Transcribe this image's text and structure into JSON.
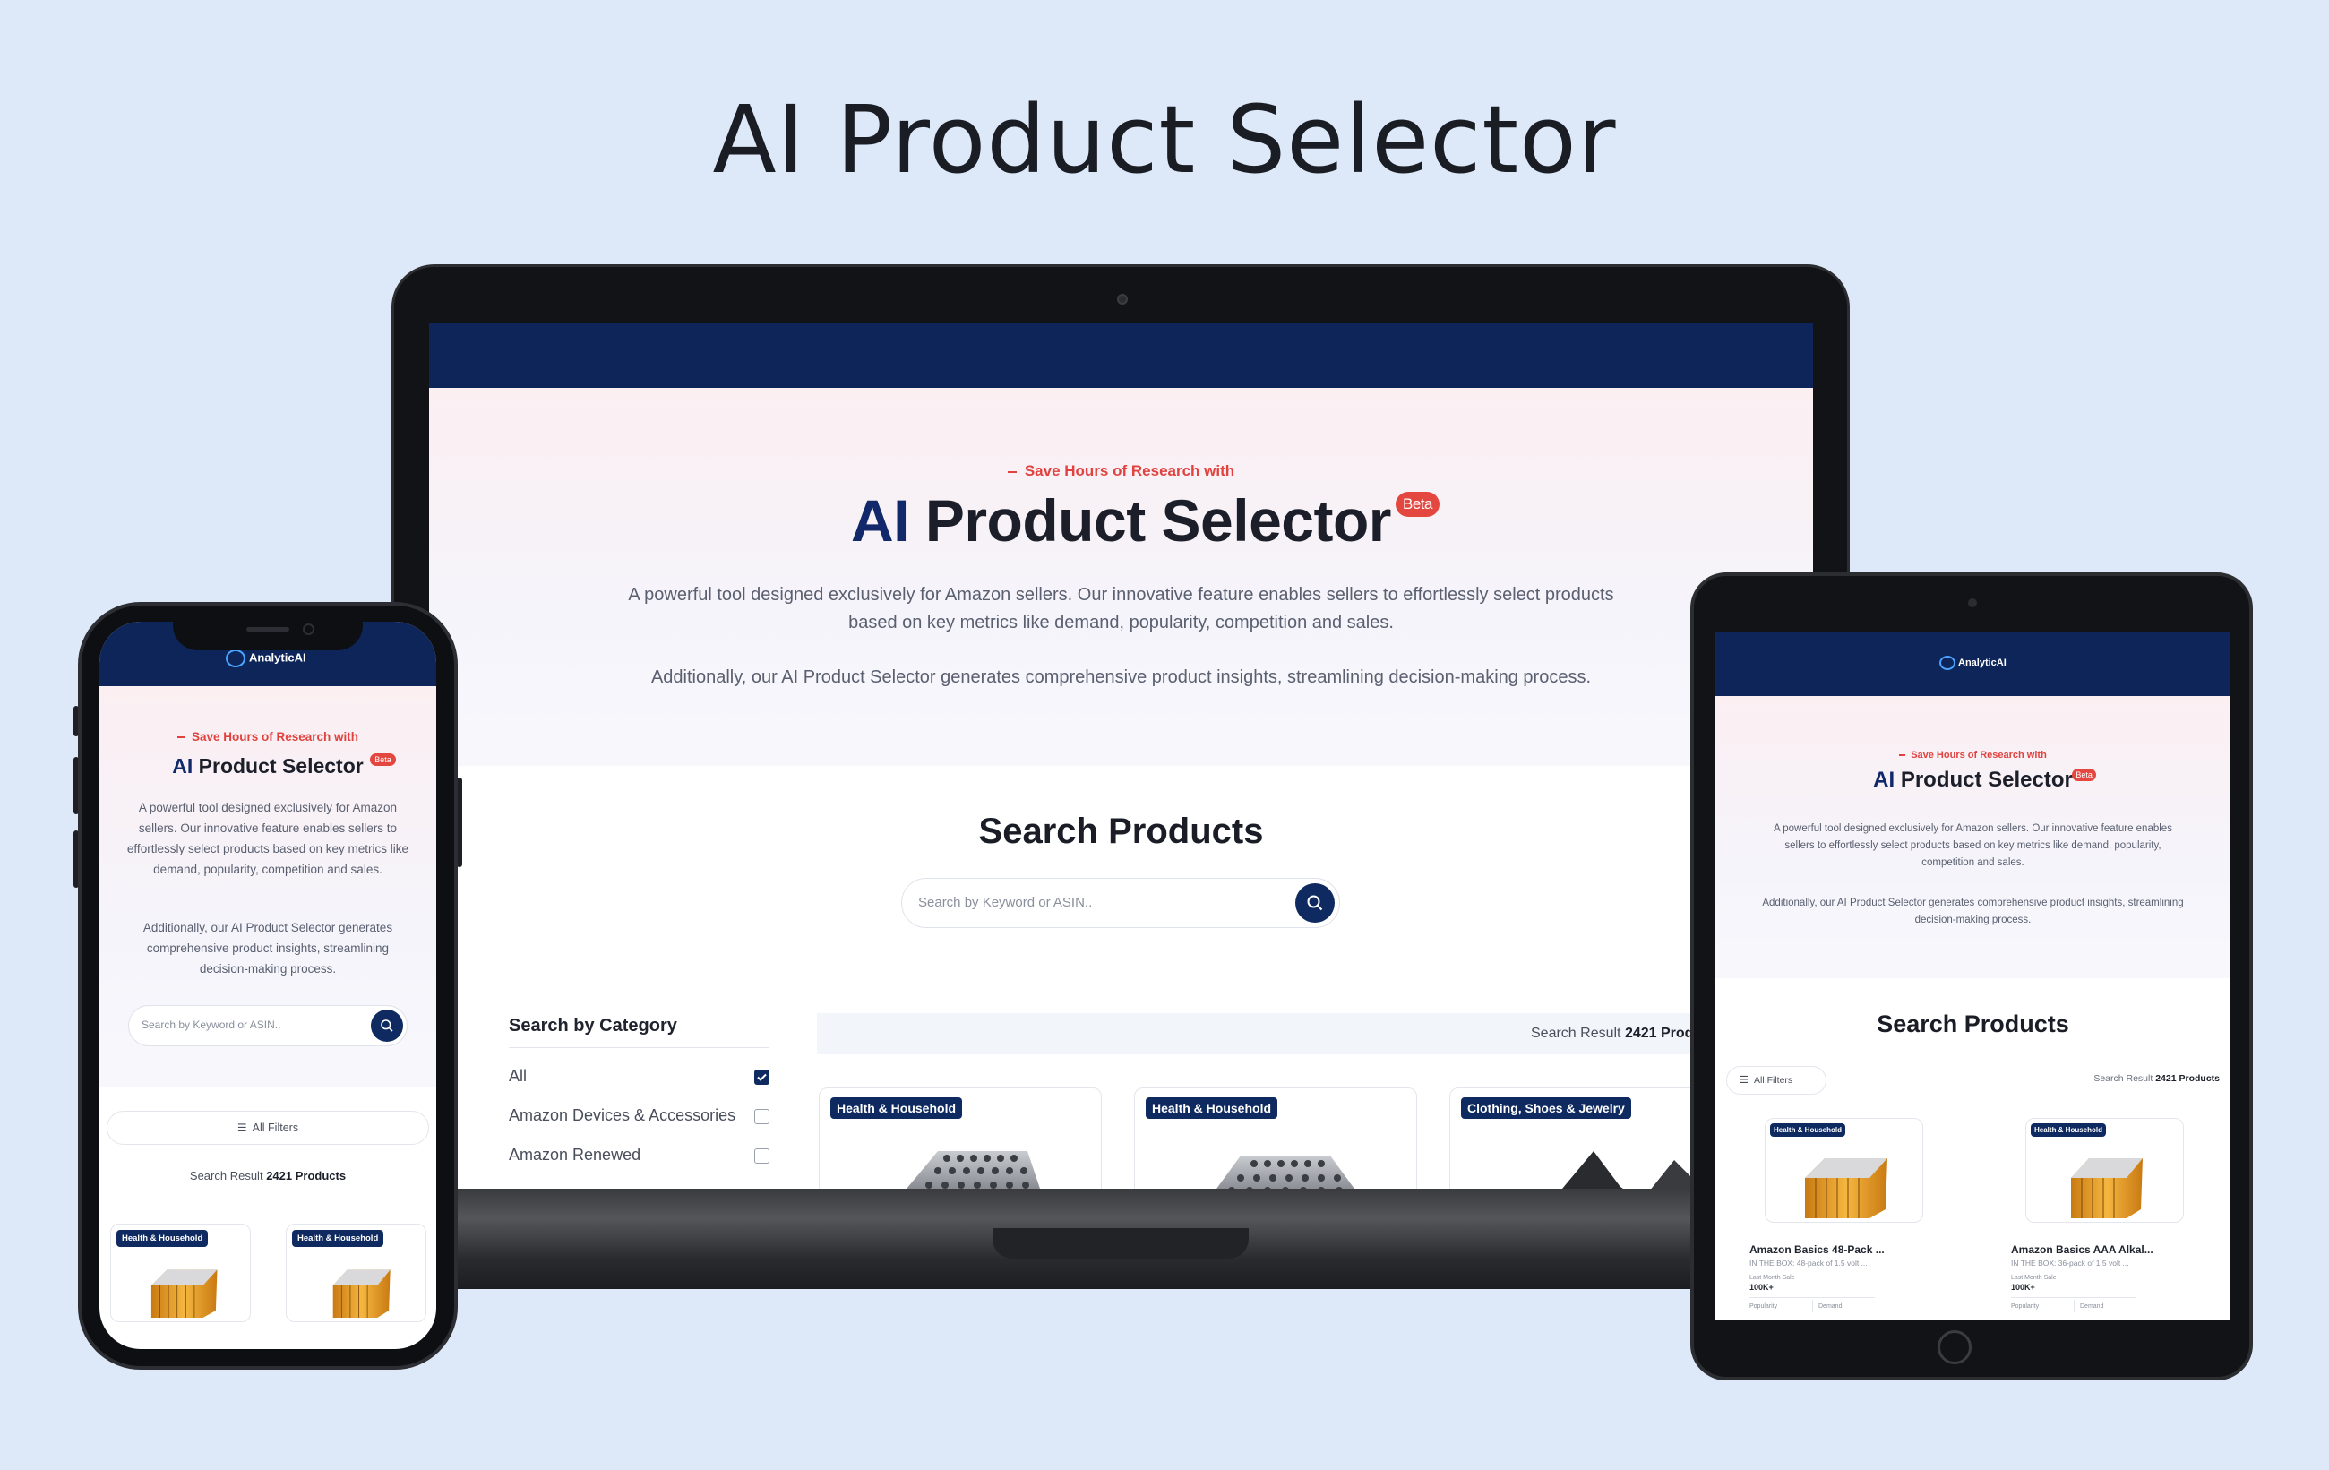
{
  "page_title": "AI Product Selector",
  "brand": {
    "name": "AnalyticAI"
  },
  "hero": {
    "tagline": "Save Hours of Research with",
    "title_ai": "AI",
    "title_rest": "Product Selector",
    "beta": "Beta",
    "description": "A powerful tool designed exclusively for Amazon sellers. Our innovative feature enables sellers to effortlessly select products based on key metrics like demand, popularity, competition and sales.",
    "description2": "Additionally, our AI Product Selector generates comprehensive product insights, streamlining decision-making process."
  },
  "search": {
    "heading": "Search Products",
    "placeholder": "Search by Keyword or ASIN.."
  },
  "categories": {
    "heading": "Search by Category",
    "items": [
      {
        "label": "All",
        "checked": true
      },
      {
        "label": "Amazon Devices & Accessories",
        "checked": false
      },
      {
        "label": "Amazon Renewed",
        "checked": false
      }
    ]
  },
  "results": {
    "prefix": "Search Result",
    "count": "2421",
    "suffix": "Products",
    "laptop_suffix": "Produ"
  },
  "filters": {
    "label": "All Filters"
  },
  "laptop_badges": [
    "Health & Household",
    "Health & Household",
    "Clothing, Shoes & Jewelry"
  ],
  "phone_badges": [
    "Health & Household",
    "Health & Household"
  ],
  "tablet_products": [
    {
      "badge": "Health & Household",
      "name": "Amazon Basics 48-Pack ...",
      "sub": "IN THE BOX: 48-pack of 1.5 volt ...",
      "metric_label": "Last Month Sale",
      "metric_value": "100K+",
      "col1": "Popularity",
      "col2": "Demand"
    },
    {
      "badge": "Health & Household",
      "name": "Amazon Basics AAA Alkal...",
      "sub": "IN THE BOX: 36-pack of 1.5 volt ...",
      "metric_label": "Last Month Sale",
      "metric_value": "100K+",
      "col1": "Popularity",
      "col2": "Demand"
    }
  ],
  "colors": {
    "navy": "#0d2558",
    "accent_red": "#e0433f",
    "background": "#dde9f9"
  }
}
